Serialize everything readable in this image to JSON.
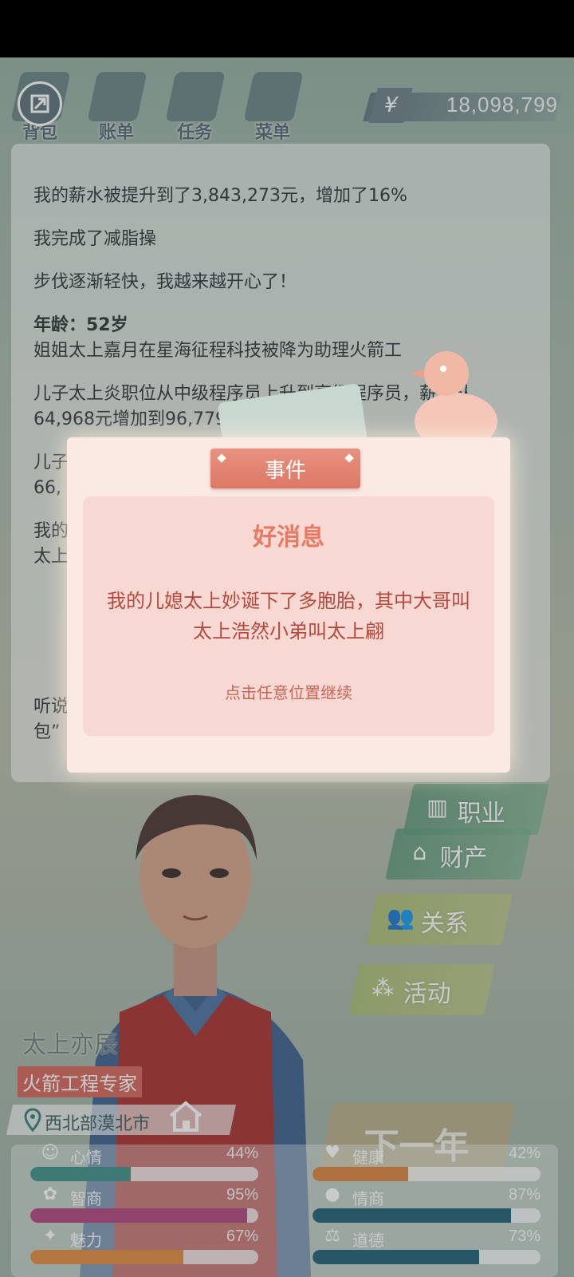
{
  "topbar": {
    "menu": [
      {
        "label": "背包",
        "icon": "backpack-icon"
      },
      {
        "label": "账单",
        "icon": "bill-icon"
      },
      {
        "label": "任务",
        "icon": "task-icon"
      },
      {
        "label": "菜单",
        "icon": "menu-icon"
      }
    ],
    "money_symbol": "¥",
    "money": "18,098,799"
  },
  "log": {
    "lines": [
      {
        "text": "我的薪水被提升到了3,843,273元，增加了16%",
        "bold": false
      },
      {
        "text": "我完成了减脂操",
        "bold": false
      },
      {
        "text": "步伐逐渐轻快，我越来越开心了！",
        "bold": false
      },
      {
        "text": "年龄：52岁",
        "bold": true
      },
      {
        "text": "姐姐太上嘉月在星海征程科技被降为助理火箭工",
        "bold": false
      },
      {
        "text": "儿子太上炎职位从中级程序员上升到高级程序员，薪水从",
        "bold": false
      },
      {
        "text": "64,968元增加到96,779",
        "bold": false
      },
      {
        "text": "儿子",
        "bold": false
      },
      {
        "text": "66,",
        "bold": false
      },
      {
        "text": "我的",
        "bold": false
      },
      {
        "text": "太上",
        "bold": false
      },
      {
        "text": "听说",
        "bold": false
      },
      {
        "text": "包”",
        "bold": false
      }
    ]
  },
  "event": {
    "tab": "事件",
    "title": "好消息",
    "message": "我的儿媳太上妙诞下了多胞胎，其中大哥叫太上浩然小弟叫太上翩",
    "hint": "点击任意位置继续"
  },
  "actions": {
    "career": "职业",
    "property": "财产",
    "relations": "关系",
    "activity": "活动",
    "next_year": "下一年"
  },
  "player": {
    "name": "太上亦辰",
    "job": "火箭工程专家",
    "location": "西北部漠北市"
  },
  "stats": [
    {
      "name": "心情",
      "value": "44%",
      "fill": 0.44,
      "color": "#3e8f8a",
      "icon": "smile-icon"
    },
    {
      "name": "健康",
      "value": "42%",
      "fill": 0.42,
      "color": "#d8823c",
      "icon": "heart-icon"
    },
    {
      "name": "智商",
      "value": "95%",
      "fill": 0.95,
      "color": "#b2457a",
      "icon": "brain-icon"
    },
    {
      "name": "情商",
      "value": "87%",
      "fill": 0.87,
      "color": "#1f5f75",
      "icon": "apple-icon"
    },
    {
      "name": "魅力",
      "value": "67%",
      "fill": 0.67,
      "color": "#e08a3c",
      "icon": "sparkle-icon"
    },
    {
      "name": "道德",
      "value": "73%",
      "fill": 0.73,
      "color": "#1f5f75",
      "icon": "scales-icon"
    }
  ]
}
